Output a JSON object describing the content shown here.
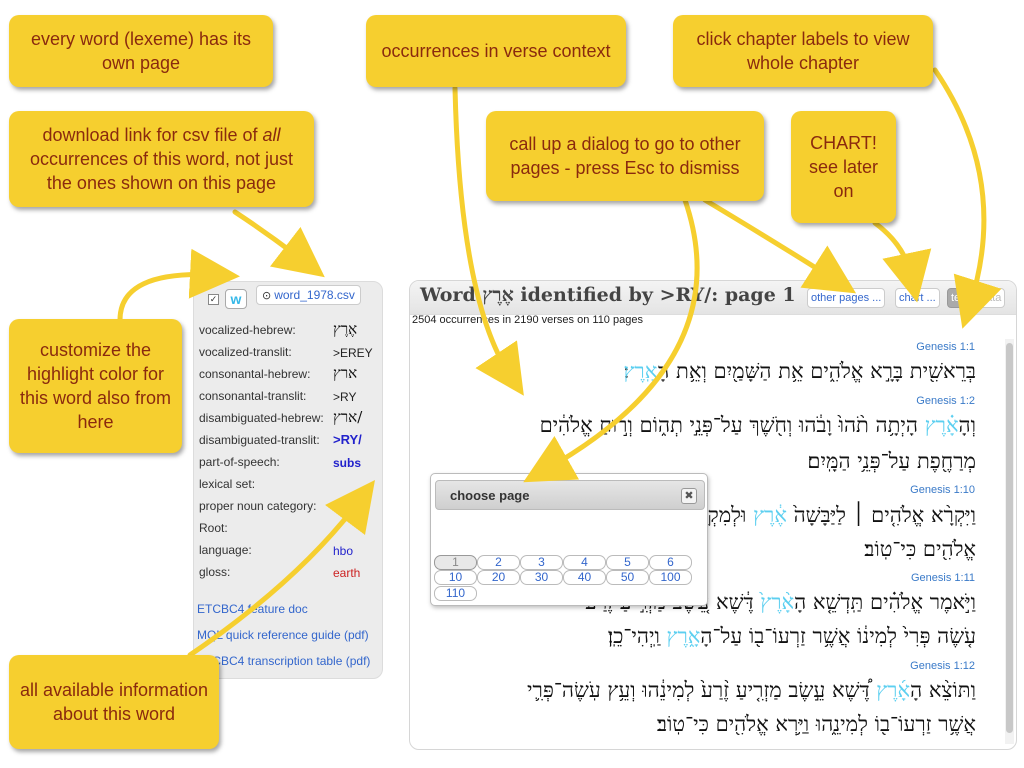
{
  "callouts": {
    "word_page": "every word (lexeme) has its own page",
    "occurrences": "occurrences in verse context",
    "chapter_labels": "click chapter labels to view whole chapter",
    "download_pre": "download link for csv file of ",
    "download_em": "all",
    "download_post": " occurrences of this word, not just the ones shown on this page",
    "dialog": "call up a dialog to go to other pages - press Esc to dismiss",
    "chart": "CHART! see later on",
    "customize": "customize the highlight color for this word also from here",
    "all_info": "all available information about this word"
  },
  "info_panel": {
    "checkbox": "✓",
    "w_button": "w",
    "csv_icon": "⊙",
    "csv_link": "word_1978.csv",
    "properties": [
      {
        "label": "vocalized-hebrew:",
        "value": "אֶרֶץ"
      },
      {
        "label": "vocalized-translit:",
        "value": ">EREY"
      },
      {
        "label": "consonantal-hebrew:",
        "value": "ארץ"
      },
      {
        "label": "consonantal-translit:",
        "value": ">RY"
      },
      {
        "label": "disambiguated-hebrew:",
        "value": "ארץ/"
      },
      {
        "label": "disambiguated-translit:",
        "value": ">RY/"
      },
      {
        "label": "part-of-speech:",
        "value": "subs"
      },
      {
        "label": "lexical set:",
        "value": ""
      },
      {
        "label": "proper noun category:",
        "value": ""
      },
      {
        "label": "Root:",
        "value": ""
      },
      {
        "label": "language:",
        "value": "hbo"
      },
      {
        "label": "gloss:",
        "value": "earth"
      }
    ],
    "links": [
      "ETCBC4 feature doc",
      "MQL quick reference guide (pdf)",
      "ETCBC4 transcription table (pdf)"
    ]
  },
  "main": {
    "title_pre": "Word ",
    "title_word": "אֶרֶץ",
    "title_post": " identified by >RY/: page 1",
    "other_pages": "other pages ...",
    "chart": "chart ...",
    "text_btn": "text",
    "data_btn": "data",
    "occurrences": "2504 occurrences in 2190 verses on 110 pages",
    "verses": [
      {
        "ref": "Genesis 1:1",
        "lines": [
          [
            "בְּרֵאשִׁ֖ית בָּרָ֣א אֱלֹהִ֑ים אֵ֥ת הַשָּׁמַ֖יִם וְאֵ֥ת הָ",
            "אָֽרֶץ",
            "׃"
          ]
        ]
      },
      {
        "ref": "Genesis 1:2",
        "lines": [
          [
            "וְהָ",
            "אָ֗רֶץ",
            " הָיְתָ֥ה תֹ֨הוּ֙ וָבֹ֔הוּ וְחֹ֖שֶׁךְ עַל־פְּנֵ֣י תְה֑וֹם וְר֣וּחַ אֱלֹהִ֔ים"
          ],
          [
            "מְרַחֶ֖פֶת עַל־פְּנֵ֥י הַמָּֽיִם׃"
          ]
        ]
      },
      {
        "ref": "Genesis 1:10",
        "lines": [
          [
            "וַיִּקְרָ֨א אֱלֹהִ֤ים ׀ לַיַּבָּשָׁה֙ ",
            "אֶ֔רֶץ",
            " וּלְמִקְוֵ֥ה הַמַּ֖יִם"
          ],
          [
            "אֱלֹהִ֖ים כִּי־טֽוֹב׃"
          ]
        ]
      },
      {
        "ref": "Genesis 1:11",
        "lines": [
          [
            "וַיֹּ֣אמֶר אֱלֹהִ֗ים תַּֽדְשֵׁ֤א הָ",
            "אָ֨רֶץ֙",
            " דֶּ֔שֶׁא עֵ֚שֶׂב מַזְרִ֣יעַ זֶ֔רַע"
          ],
          [
            "עֹ֤שֶׂה פְּרִי֙ לְמִינ֔וֹ אֲשֶׁ֥ר זַרְעוֹ־ב֖וֹ עַל־הָ",
            "אָ֑רֶץ",
            " וַֽיְהִי־כֵֽן׃"
          ]
        ]
      },
      {
        "ref": "Genesis 1:12",
        "lines": [
          [
            "וַתּוֹצֵ֨א הָ",
            "אָ֜רֶץ",
            " דֶּ֠שֶׁא עֵ֣שֶׂב מַזְרִ֤יעַ זֶ֨רַע֙ לְמִינֵ֔הוּ וְעֵ֥ץ עֹֽשֶׂה־פְּרִ֛י"
          ],
          [
            "אֲשֶׁ֥ר זַרְעוֹ־ב֖וֹ לְמִינֵ֑הוּ וַיַּ֥רְא אֱלֹהִ֖ים כִּי־טֽוֹב׃"
          ]
        ]
      }
    ]
  },
  "dialog": {
    "title": "choose page",
    "close": "✖",
    "pages": [
      "1",
      "2",
      "3",
      "4",
      "5",
      "6",
      "10",
      "20",
      "30",
      "40",
      "50",
      "100",
      "110"
    ],
    "current": "1"
  },
  "colors": {
    "callout_bg": "#f6cf2f",
    "callout_text": "#8a2a0e",
    "highlight": "#5ccff0",
    "link": "#3366cc"
  }
}
